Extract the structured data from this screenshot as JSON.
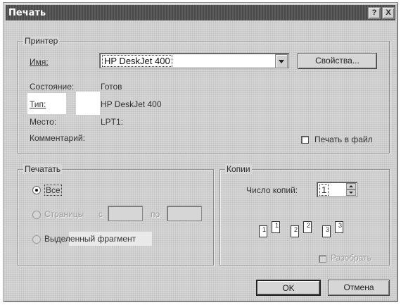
{
  "window": {
    "title": "Печать",
    "help_button": "?",
    "close_button": "X"
  },
  "printer": {
    "legend": "Принтер",
    "name_label": "Имя:",
    "name_value": "HP DeskJet 400",
    "properties_button": "Свойства...",
    "status_label": "Состояние:",
    "status_value": "Готов",
    "type_label": "Тип:",
    "type_value": "HP DeskJet 400",
    "place_label": "Место:",
    "place_value": "LPT1:",
    "comment_label": "Комментарий:",
    "print_to_file_label": "Печать в файл",
    "print_to_file_checked": false
  },
  "range": {
    "legend": "Печатать",
    "all_label": "Все",
    "pages_label": "Страницы",
    "from_label": "с",
    "to_label": "по",
    "from_value": "",
    "to_value": "",
    "selection_label": "Выделенный фрагмент",
    "selected": "all"
  },
  "copies": {
    "legend": "Копии",
    "count_label": "Число копий:",
    "count_value": "1",
    "page_numbers": [
      "1",
      "1",
      "2",
      "2",
      "3",
      "3"
    ],
    "collate_label": "Разобрать",
    "collate_checked": false
  },
  "buttons": {
    "ok": "OK",
    "cancel": "Отмена"
  }
}
